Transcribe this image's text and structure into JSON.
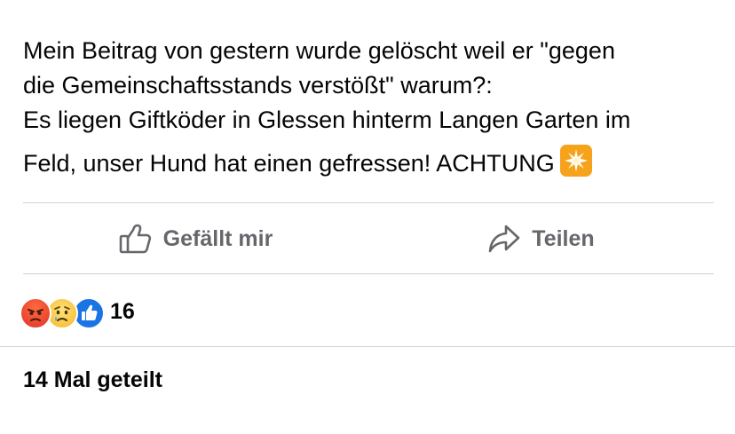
{
  "post": {
    "lines": [
      "Mein Beitrag von gestern wurde gelöscht weil er \"gegen",
      "die Gemeinschaftsstands verstößt\" warum?:",
      "Es liegen Giftköder in Glessen hinterm Langen Garten im",
      "Feld, unser Hund hat einen gefressen! ACHTUNG"
    ],
    "emoji_icon": "eight-pointed-star-icon",
    "emoji_color": "#F7A21B"
  },
  "actions": {
    "like_label": "Gefällt mir",
    "like_icon": "thumbs-up-icon",
    "share_label": "Teilen",
    "share_icon": "share-arrow-icon",
    "text_color": "#65676B"
  },
  "reactions": {
    "icons": [
      "angry-reaction-icon",
      "sad-reaction-icon",
      "like-reaction-icon"
    ],
    "count": "16",
    "like_color": "#1B74E4"
  },
  "shares": {
    "label": "14 Mal geteilt"
  }
}
